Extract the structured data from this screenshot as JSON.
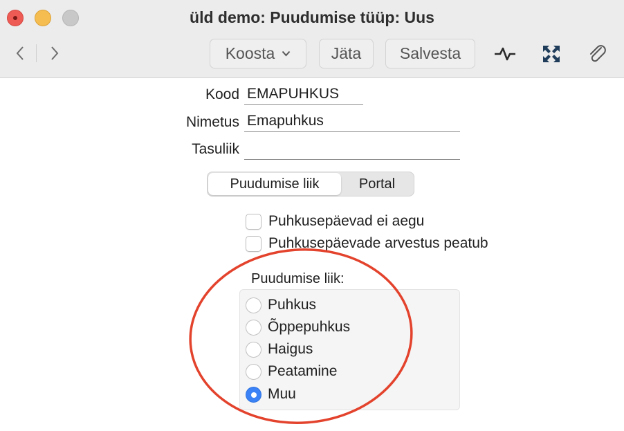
{
  "window": {
    "title": "üld demo: Puudumise tüüp: Uus"
  },
  "toolbar": {
    "compose_label": "Koosta",
    "discard_label": "Jäta",
    "save_label": "Salvesta"
  },
  "form": {
    "kood": {
      "label": "Kood",
      "value": "EMAPUHKUS"
    },
    "nimetus": {
      "label": "Nimetus",
      "value": "Emapuhkus"
    },
    "tasuliik": {
      "label": "Tasuliik",
      "value": ""
    }
  },
  "tabs": [
    {
      "label": "Puudumise liik",
      "active": true
    },
    {
      "label": "Portal",
      "active": false
    }
  ],
  "checkboxes": [
    {
      "label": "Puhkusepäevad ei aegu",
      "checked": false
    },
    {
      "label": "Puhkusepäevade arvestus peatub",
      "checked": false
    }
  ],
  "absence_type": {
    "label": "Puudumise liik:",
    "options": [
      {
        "label": "Puhkus",
        "selected": false
      },
      {
        "label": "Õppepuhkus",
        "selected": false
      },
      {
        "label": "Haigus",
        "selected": false
      },
      {
        "label": "Peatamine",
        "selected": false
      },
      {
        "label": "Muu",
        "selected": true
      }
    ]
  },
  "colors": {
    "annotation": "#e3422c",
    "radio_selected": "#3b82f6"
  }
}
